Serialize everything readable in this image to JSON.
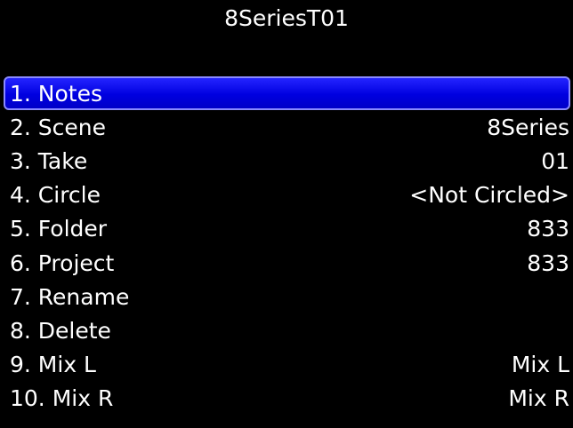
{
  "title": "8SeriesT01",
  "colors": {
    "background": "#000000",
    "text": "#ffffff",
    "selection": "#0000e0"
  },
  "menu": {
    "items": [
      {
        "label": "1. Notes",
        "value": ""
      },
      {
        "label": "2. Scene",
        "value": "8Series"
      },
      {
        "label": "3. Take",
        "value": "01"
      },
      {
        "label": "4. Circle",
        "value": "<Not Circled>"
      },
      {
        "label": "5. Folder",
        "value": "833"
      },
      {
        "label": "6. Project",
        "value": "833"
      },
      {
        "label": "7. Rename",
        "value": ""
      },
      {
        "label": "8. Delete",
        "value": ""
      },
      {
        "label": "9. Mix L",
        "value": "Mix L"
      },
      {
        "label": "10. Mix R",
        "value": "Mix R"
      }
    ]
  }
}
